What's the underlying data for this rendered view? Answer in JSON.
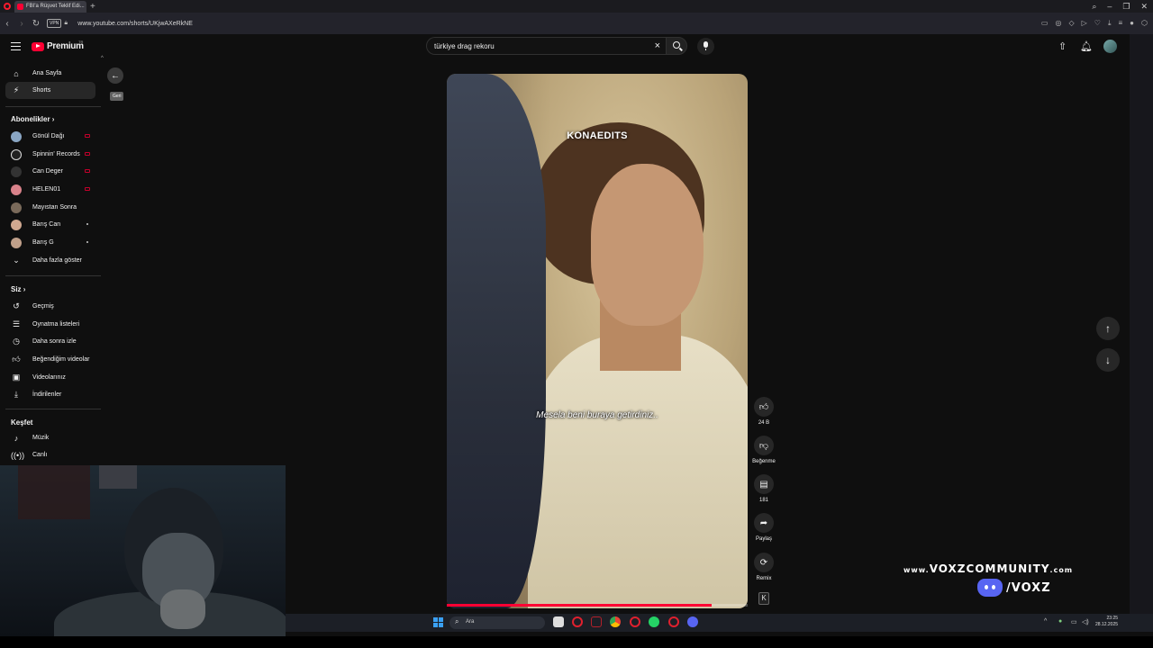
{
  "browser": {
    "tab_title": "FBI'a Rüşvet Teklif Edi...",
    "url": "www.youtube.com/shorts/UKjwAXeRkNE",
    "vpn_label": "VPN"
  },
  "header": {
    "logo_text": "Premium",
    "logo_sup": "TR",
    "search_query": "türkiye drag rekoru"
  },
  "sidebar": {
    "main": [
      {
        "label": "Ana Sayfa",
        "icon": "home-icon"
      },
      {
        "label": "Shorts",
        "icon": "shorts-icon"
      }
    ],
    "subs_title": "Abonelikler",
    "subscriptions": [
      {
        "label": "Gönül Dağı",
        "status": "live",
        "color": "#8aa6c4"
      },
      {
        "label": "Spinnin' Records",
        "status": "live",
        "color": "#222222"
      },
      {
        "label": "Can Deger",
        "status": "live",
        "color": "#333333"
      },
      {
        "label": "HELEN01",
        "status": "live",
        "color": "#d9828a"
      },
      {
        "label": "Mayıstan Sonra",
        "status": "",
        "color": "#7a6a5a"
      },
      {
        "label": "Barış Can",
        "status": "dot",
        "color": "#d0a890"
      },
      {
        "label": "Barış G",
        "status": "dot",
        "color": "#c0a08a"
      }
    ],
    "show_more": "Daha fazla göster",
    "you_title": "Siz",
    "you_items": [
      {
        "label": "Geçmiş",
        "icon": "history-icon"
      },
      {
        "label": "Oynatma listeleri",
        "icon": "playlist-icon"
      },
      {
        "label": "Daha sonra izle",
        "icon": "watch-later-icon"
      },
      {
        "label": "Beğendiğim videolar",
        "icon": "thumbs-up-icon"
      },
      {
        "label": "Videolarınız",
        "icon": "your-videos-icon"
      },
      {
        "label": "İndirilenler",
        "icon": "download-icon"
      }
    ],
    "explore_title": "Keşfet",
    "explore_items": [
      {
        "label": "Müzik",
        "icon": "music-icon"
      },
      {
        "label": "Canlı",
        "icon": "live-icon"
      }
    ]
  },
  "back_tooltip": "Geri",
  "video": {
    "watermark": "KONAEDITS",
    "subtitle": "Mesela beni buraya getirdiniz..",
    "progress_fraction": 0.88
  },
  "actions": {
    "like_count": "24 B",
    "dislike_label": "Beğenme",
    "comment_count": "181",
    "share_label": "Paylaş",
    "remix_label": "Remix"
  },
  "overlay_brand": {
    "line1_prefix": "www.",
    "line1_main": "VOXZCOMMUNITY",
    "line1_suffix": ".com",
    "line2": "/VOXZ"
  },
  "taskbar": {
    "search_placeholder": "Ara",
    "time": "23:25",
    "date": "28.12.2025"
  },
  "colors": {
    "accent": "#ff0033",
    "background": "#0f0f0f"
  }
}
